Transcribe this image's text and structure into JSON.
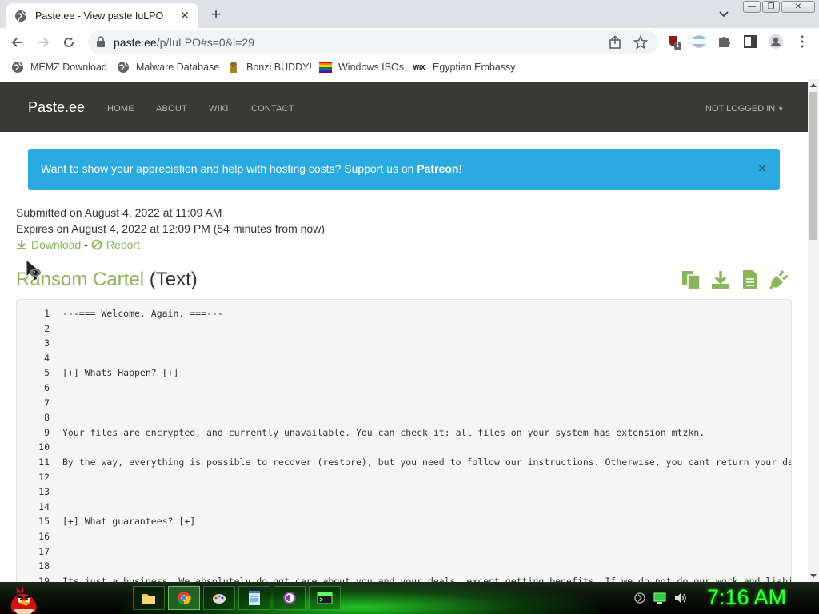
{
  "browser": {
    "tab": {
      "title": "Paste.ee - View paste IuLPO",
      "close_label": "✕"
    },
    "new_tab_label": "+",
    "window_controls": {
      "minimize": "—",
      "maximize": "❐",
      "close": "✕"
    },
    "url": {
      "host": "paste.ee",
      "path": "/p/IuLPO#s=0&l=29"
    },
    "extension_badge": "1",
    "bookmarks": [
      {
        "label": "MEMZ Download",
        "icon": "globe-icon"
      },
      {
        "label": "Malware Database",
        "icon": "globe-icon"
      },
      {
        "label": "Bonzi BUDDY!",
        "icon": "bonzi-icon"
      },
      {
        "label": "Windows ISOs",
        "icon": "windows-flag-icon"
      },
      {
        "label": "Egyptian Embassy",
        "icon": "wix-icon",
        "icon_text": "WiX"
      }
    ]
  },
  "site": {
    "brand": "Paste.ee",
    "nav": [
      "HOME",
      "ABOUT",
      "WIKI",
      "CONTACT"
    ],
    "account": "NOT LOGGED IN",
    "alert": {
      "text": "Want to show your appreciation and help with hosting costs? Support us on ",
      "link": "Patreon",
      "suffix": "!",
      "close": "×"
    },
    "submitted": "Submitted on August 4, 2022 at 11:09 AM",
    "expires": "Expires on August 4, 2022 at 12:09 PM (54 minutes from now)",
    "download_label": "Download",
    "separator": "-",
    "report_label": "Report",
    "paste_name": "Ransom Cartel",
    "paste_type": "(Text)",
    "lines": [
      {
        "n": "1",
        "text": "---=== Welcome. Again. ===---"
      },
      {
        "n": "2",
        "text": ""
      },
      {
        "n": "3",
        "text": ""
      },
      {
        "n": "4",
        "text": ""
      },
      {
        "n": "5",
        "text": "[+] Whats Happen? [+]"
      },
      {
        "n": "6",
        "text": ""
      },
      {
        "n": "7",
        "text": ""
      },
      {
        "n": "8",
        "text": ""
      },
      {
        "n": "9",
        "text": "Your files are encrypted, and currently unavailable. You can check it: all files on your system has extension mtzkn."
      },
      {
        "n": "10",
        "text": ""
      },
      {
        "n": "11",
        "text": "By the way, everything is possible to recover (restore), but you need to follow our instructions. Otherwise, you cant return your data (NEVER)."
      },
      {
        "n": "12",
        "text": ""
      },
      {
        "n": "13",
        "text": ""
      },
      {
        "n": "14",
        "text": ""
      },
      {
        "n": "15",
        "text": "[+] What guarantees? [+]"
      },
      {
        "n": "16",
        "text": ""
      },
      {
        "n": "17",
        "text": ""
      },
      {
        "n": "18",
        "text": ""
      },
      {
        "n": "19",
        "text": "Its just a business. We absolutely do not care about you and your deals, except getting benefits. If we do not do our work and liabilities - nobody will not cooperate with us."
      }
    ]
  },
  "taskbar": {
    "clock": "7:16 AM",
    "apps": [
      "folder-icon",
      "chrome-icon",
      "paint-icon",
      "notepad-icon",
      "tor-icon",
      "terminal-icon"
    ]
  },
  "colors": {
    "accent_green": "#8ab55a",
    "navbar": "#393a35",
    "alert_blue": "#2ba9e1",
    "clock_green": "#3cff3c"
  }
}
